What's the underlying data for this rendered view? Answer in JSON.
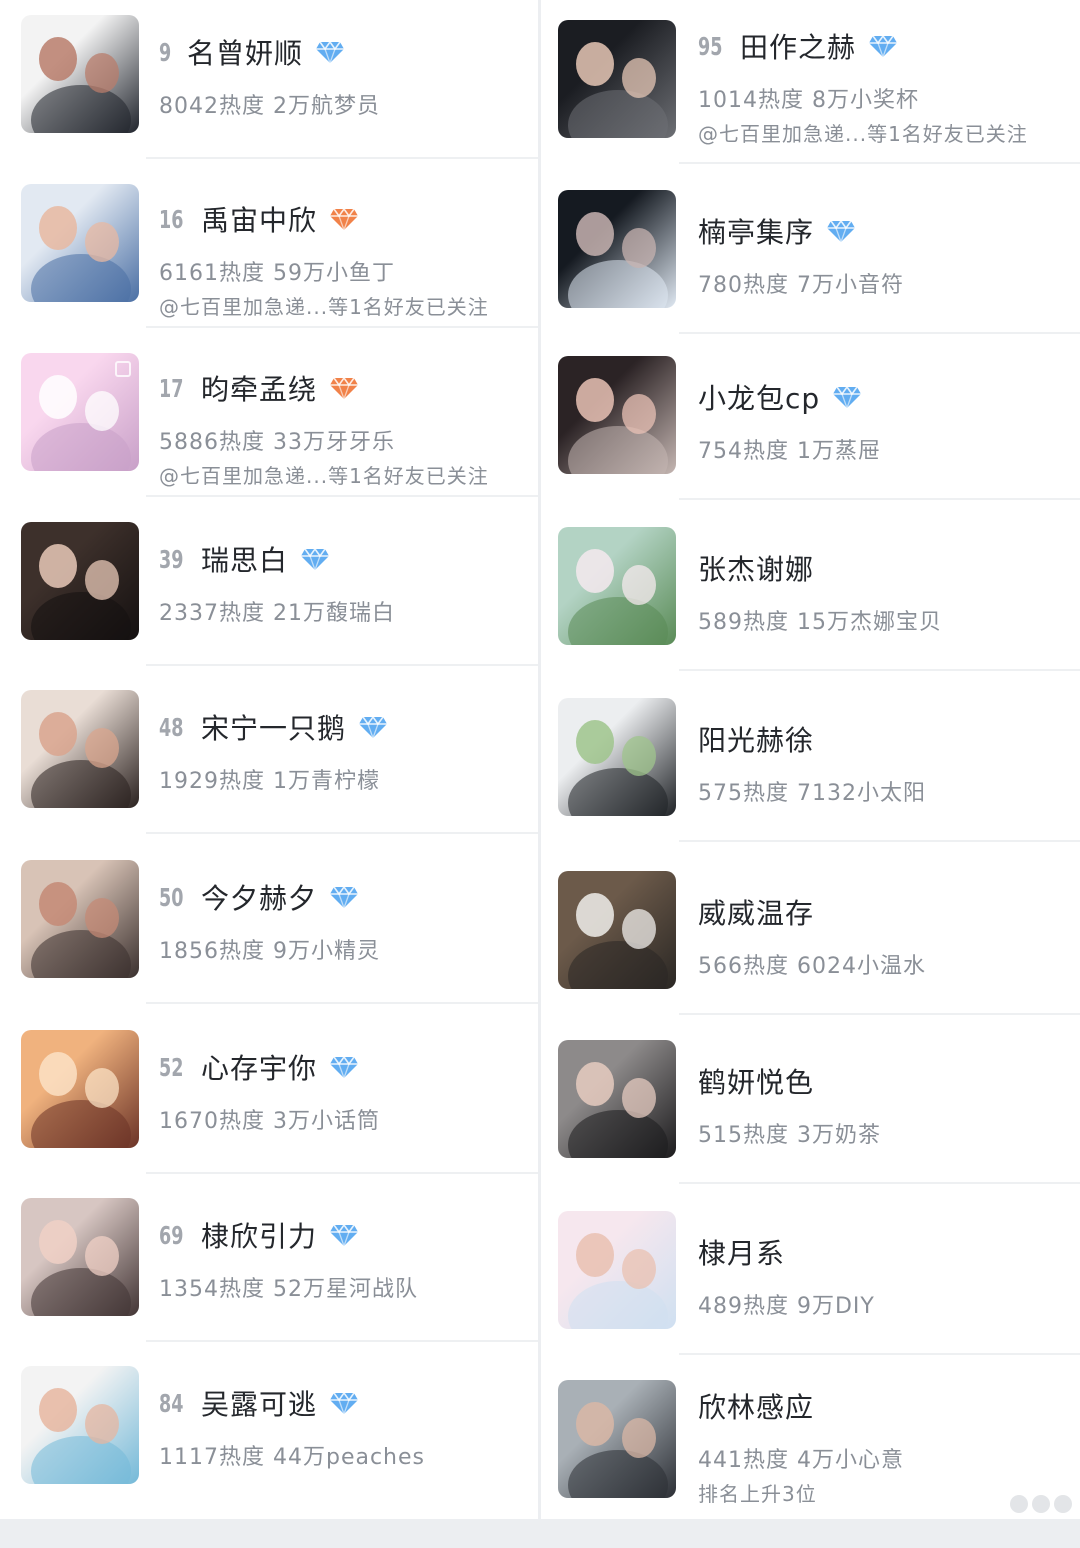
{
  "left": [
    {
      "rank": "9",
      "name": "名曾妍顺",
      "badge": "blue",
      "stats": "8042热度 2万航梦员",
      "note": "",
      "thumb": [
        "#f3f3f3",
        "#20242c",
        "#b87c6b"
      ]
    },
    {
      "rank": "16",
      "name": "禹宙中欣",
      "badge": "orange",
      "stats": "6161热度 59万小鱼丁",
      "note": "@七百里加急递...等1名好友已关注",
      "thumb": [
        "#e2e9f2",
        "#4a6fa4",
        "#e8b8a1"
      ]
    },
    {
      "rank": "17",
      "name": "昀牵孟绕",
      "badge": "orange",
      "stats": "5886热度 33万牙牙乐",
      "note": "@七百里加急递...等1名好友已关注",
      "thumb": [
        "#f9d7ee",
        "#c8a0c8",
        "#ffffff"
      ]
    },
    {
      "rank": "39",
      "name": "瑞思白",
      "badge": "blue",
      "stats": "2337热度 21万馥瑞白",
      "note": "",
      "thumb": [
        "#3d302b",
        "#141010",
        "#e9c9b8"
      ]
    },
    {
      "rank": "48",
      "name": "宋宁一只鹅",
      "badge": "blue",
      "stats": "1929热度 1万青柠檬",
      "note": "",
      "thumb": [
        "#e9ddd5",
        "#2a211f",
        "#d9a58e"
      ]
    },
    {
      "rank": "50",
      "name": "今夕赫夕",
      "badge": "blue",
      "stats": "1856热度 9万小精灵",
      "note": "",
      "thumb": [
        "#d8c3b6",
        "#3a302e",
        "#c48a75"
      ]
    },
    {
      "rank": "52",
      "name": "心存宇你",
      "badge": "blue",
      "stats": "1670热度 3万小话筒",
      "note": "",
      "thumb": [
        "#f0b27e",
        "#6b3327",
        "#fbe1c4"
      ]
    },
    {
      "rank": "69",
      "name": "棣欣引力",
      "badge": "blue",
      "stats": "1354热度 52万星河战队",
      "note": "",
      "thumb": [
        "#d7c6c2",
        "#423535",
        "#f0d0c6"
      ]
    },
    {
      "rank": "84",
      "name": "吴露可逃",
      "badge": "blue",
      "stats": "1117热度 44万peaches",
      "note": "",
      "thumb": [
        "#f3f3f3",
        "#74b9d8",
        "#e6b6a0"
      ]
    }
  ],
  "right": [
    {
      "rank": "95",
      "name": "田作之赫",
      "badge": "blue",
      "stats": "1014热度 8万小奖杯",
      "note": "@七百里加急递...等1名好友已关注",
      "thumb": [
        "#1b1d22",
        "#6d6f74",
        "#e6c7b5"
      ]
    },
    {
      "rank": "",
      "name": "楠亭集序",
      "badge": "blue",
      "stats": "780热度 7万小音符",
      "note": "",
      "thumb": [
        "#151a21",
        "#dfe8f2",
        "#c7b3b0"
      ]
    },
    {
      "rank": "",
      "name": "小龙包cp",
      "badge": "blue",
      "stats": "754热度 1万蒸屉",
      "note": "",
      "thumb": [
        "#2b2325",
        "#c5b6b2",
        "#e9c2b5"
      ]
    },
    {
      "rank": "",
      "name": "张杰谢娜",
      "badge": "",
      "stats": "589热度 15万杰娜宝贝",
      "note": "",
      "thumb": [
        "#b3d3c4",
        "#5a8b56",
        "#f5e9ee"
      ]
    },
    {
      "rank": "",
      "name": "阳光赫徐",
      "badge": "",
      "stats": "575热度 7132小太阳",
      "note": "",
      "thumb": [
        "#eceef0",
        "#1f2226",
        "#9fc48c"
      ]
    },
    {
      "rank": "",
      "name": "威威温存",
      "badge": "",
      "stats": "566热度 6024小温水",
      "note": "",
      "thumb": [
        "#6c5a4a",
        "#2a2724",
        "#f0eeeb"
      ]
    },
    {
      "rank": "",
      "name": "鹤妍悦色",
      "badge": "",
      "stats": "515热度 3万奶茶",
      "note": "",
      "thumb": [
        "#8d8a8a",
        "#1c1b1d",
        "#e6cbc0"
      ]
    },
    {
      "rank": "",
      "name": "棣月系",
      "badge": "",
      "stats": "489热度 9万DIY",
      "note": "",
      "thumb": [
        "#f6e7ee",
        "#cfe0f1",
        "#e9c0b0"
      ]
    },
    {
      "rank": "",
      "name": "欣林感应",
      "badge": "",
      "stats": "441热度 4万小心意",
      "note": "排名上升3位",
      "thumb": [
        "#a9b0b6",
        "#2c2f35",
        "#d9b7a6"
      ]
    }
  ],
  "colors": {
    "badge_blue": "#5aa9f0",
    "badge_orange": "#f07b3f",
    "text_primary": "#24272c",
    "text_secondary": "#8a8f97",
    "rank": "#a2a6ad"
  },
  "icons": {
    "badge_blue": "blue-diamond-badge-icon",
    "badge_orange": "orange-diamond-badge-icon"
  }
}
